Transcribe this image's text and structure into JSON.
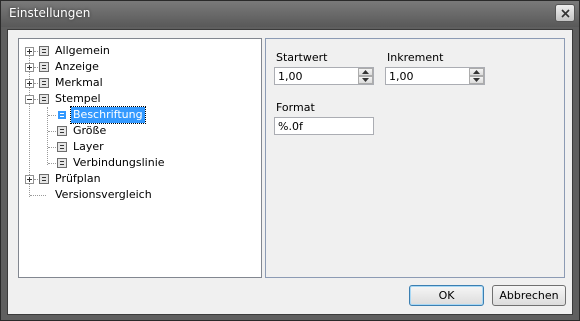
{
  "window": {
    "title": "Einstellungen"
  },
  "tree": {
    "items": [
      {
        "label": "Allgemein",
        "expander": "plus",
        "selected": false
      },
      {
        "label": "Anzeige",
        "expander": "plus",
        "selected": false
      },
      {
        "label": "Merkmal",
        "expander": "plus",
        "selected": false
      },
      {
        "label": "Stempel",
        "expander": "minus",
        "selected": false
      },
      {
        "label": "Beschriftung",
        "expander": "none",
        "selected": true
      },
      {
        "label": "Größe",
        "expander": "none",
        "selected": false
      },
      {
        "label": "Layer",
        "expander": "none",
        "selected": false
      },
      {
        "label": "Verbindungslinie",
        "expander": "none",
        "selected": false
      },
      {
        "label": "Prüfplan",
        "expander": "plus",
        "selected": false
      },
      {
        "label": "Versionsvergleich",
        "expander": "none",
        "selected": false
      }
    ]
  },
  "panel": {
    "startwert": {
      "label": "Startwert",
      "value": "1,00"
    },
    "inkrement": {
      "label": "Inkrement",
      "value": "1,00"
    },
    "format": {
      "label": "Format",
      "value": "%.0f"
    }
  },
  "buttons": {
    "ok": "OK",
    "cancel": "Abbrechen"
  },
  "colors": {
    "selection": "#3399ff",
    "dialog_bg": "#f0f0f0",
    "title_bg": "#5f5f5f"
  }
}
